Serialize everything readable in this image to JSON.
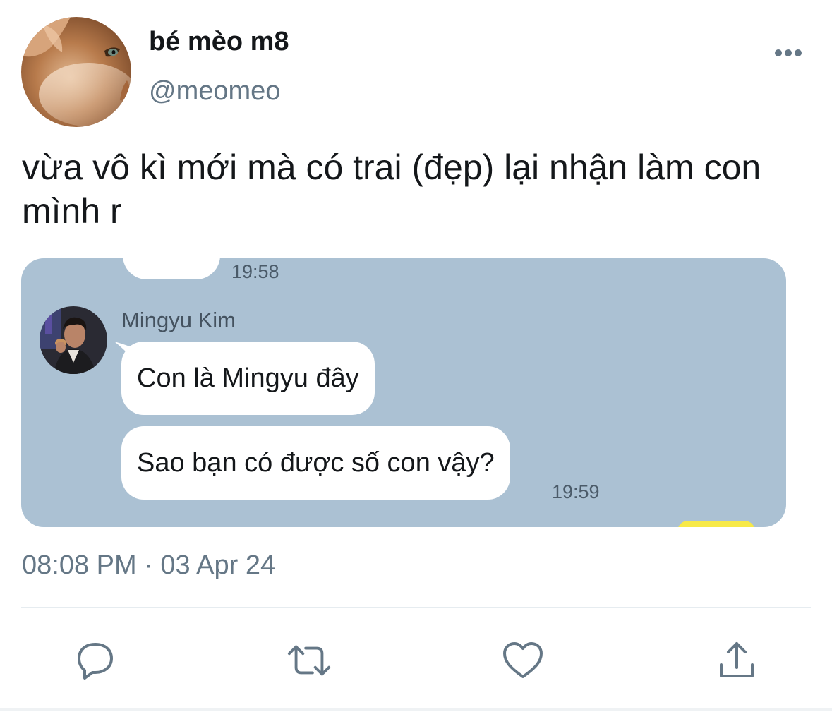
{
  "author": {
    "display_name": "bé mèo m8",
    "handle": "@meomeo",
    "avatar_icon": "cat-photo-avatar",
    "more_icon": "more-dots-icon"
  },
  "tweet": {
    "text": "vừa vô kì mới mà có trai (đẹp) lại nhận làm con mình r",
    "timestamp": "08:08 PM · 03 Apr 24"
  },
  "media": {
    "background_color": "#abc1d3",
    "previous_message_time": "19:58",
    "sender": {
      "name": "Mingyu Kim",
      "avatar_icon": "person-photo-avatar"
    },
    "messages": [
      {
        "text": "Con là Mingyu đây"
      },
      {
        "text": "Sao bạn có được số con vậy?",
        "time": "19:59"
      }
    ]
  },
  "actions": [
    {
      "name": "reply",
      "icon": "reply-icon"
    },
    {
      "name": "retweet",
      "icon": "retweet-icon"
    },
    {
      "name": "like",
      "icon": "heart-icon"
    },
    {
      "name": "share",
      "icon": "share-icon"
    }
  ],
  "colors": {
    "text_primary": "#14171a",
    "text_secondary": "#657786",
    "icon_gray": "#657786",
    "divider": "#e6ecf0"
  }
}
